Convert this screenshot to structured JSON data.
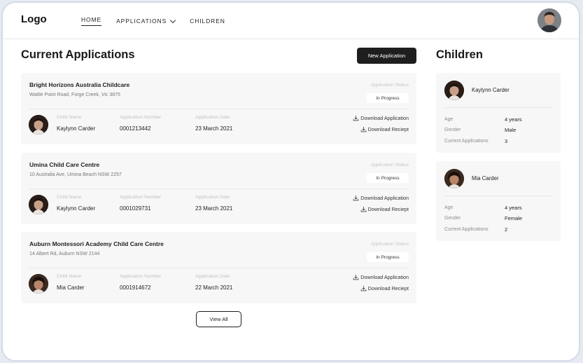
{
  "header": {
    "logo": "Logo",
    "nav": [
      {
        "label": "HOME"
      },
      {
        "label": "APPLICATIONS"
      },
      {
        "label": "CHILDREN"
      }
    ]
  },
  "applications": {
    "title": "Current Applications",
    "new_button": "New Application",
    "view_all": "View All",
    "labels": {
      "child_name": "Child Name",
      "application_number": "Application Number",
      "application_date": "Application Date",
      "application_status": "Application Status",
      "download_application": "Download Application",
      "download_receipt": "Download Reciept"
    },
    "items": [
      {
        "centre": "Bright Horizons Australia Childcare",
        "address": "Wattle Point Road, Forge Creek, Vic 3875",
        "status": "In Progress",
        "child_name": "Kaylynn Carder",
        "number": "0001213442",
        "date": "23 March 2021"
      },
      {
        "centre": "Umina Child Care Centre",
        "address": "10 Australia Ave, Umina Beach NSW 2257",
        "status": "In Progress",
        "child_name": "Kaylynn Carder",
        "number": "0001029731",
        "date": "23 March 2021"
      },
      {
        "centre": "Auburn Montessori Academy Child Care Centre",
        "address": "14 Albert Rd, Auburn NSW 2144",
        "status": "In Progress",
        "child_name": "Mia Carder",
        "number": "0001914672",
        "date": "22 March 2021"
      }
    ]
  },
  "children": {
    "title": "Children",
    "labels": {
      "age": "Age",
      "gender": "Gender",
      "current_applications": "Current Applications"
    },
    "items": [
      {
        "name": "Kaylynn Carder",
        "age": "4 years",
        "gender": "Male",
        "current_applications": "3"
      },
      {
        "name": "Mia Carder",
        "age": "4 years",
        "gender": "Female",
        "current_applications": "2"
      }
    ]
  }
}
